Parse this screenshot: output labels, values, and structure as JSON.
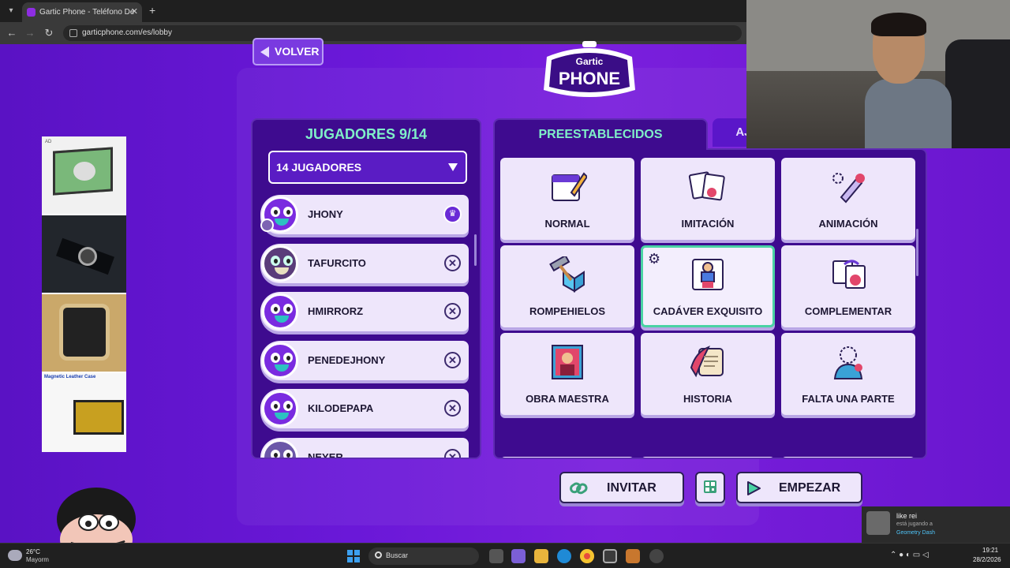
{
  "browser": {
    "tab_title": "Gartic Phone - Teléfono De",
    "url": "garticphone.com/es/lobby"
  },
  "header": {
    "back_label": "VOLVER",
    "logo_top": "Gartic",
    "logo_bottom": "PHONE"
  },
  "players": {
    "title": "JUGADORES 9/14",
    "select_value": "14 JUGADORES",
    "list": [
      {
        "name": "JHONY",
        "role": "host"
      },
      {
        "name": "TAFURCITO",
        "role": "player"
      },
      {
        "name": "HMIRRORZ",
        "role": "player"
      },
      {
        "name": "PENEDEJHONY",
        "role": "player"
      },
      {
        "name": "KILODEPAPA",
        "role": "player"
      },
      {
        "name": "NEYER",
        "role": "player"
      }
    ]
  },
  "presets": {
    "tab_preset": "PREESTABLECIDOS",
    "tab_custom": "AJUSTES PERSONALIZADOS",
    "cards": [
      {
        "label": "NORMAL",
        "icon": "calendar-pencil-icon"
      },
      {
        "label": "IMITACIÓN",
        "icon": "cards-icon"
      },
      {
        "label": "ANIMACIÓN",
        "icon": "animation-pen-icon"
      },
      {
        "label": "ROMPEHIELOS",
        "icon": "hammer-ice-icon"
      },
      {
        "label": "CADÁVER EXQUISITO",
        "icon": "exquisite-corpse-icon",
        "selected": true
      },
      {
        "label": "COMPLEMENTAR",
        "icon": "complement-icon"
      },
      {
        "label": "OBRA MAESTRA",
        "icon": "masterpiece-icon"
      },
      {
        "label": "HISTORIA",
        "icon": "scroll-quill-icon"
      },
      {
        "label": "FALTA UNA PARTE",
        "icon": "missing-piece-icon"
      }
    ]
  },
  "actions": {
    "invite_label": "INVITAR",
    "start_label": "EMPEZAR"
  },
  "ads": {
    "ad_tag": "AD",
    "case_text": "Magnetic Leather Case"
  },
  "notification": {
    "name": "like rei",
    "status": "está jugando a",
    "game": "Geometry Dash"
  },
  "taskbar": {
    "temp": "26°C",
    "condition": "Mayorm",
    "search_label": "Buscar",
    "time": "19:21",
    "date": "28/2/2026"
  },
  "colors": {
    "accent": "#7ff0c8",
    "page_purple": "#6a18d8",
    "panel": "#3e0b8f",
    "card": "#eee6fb"
  }
}
